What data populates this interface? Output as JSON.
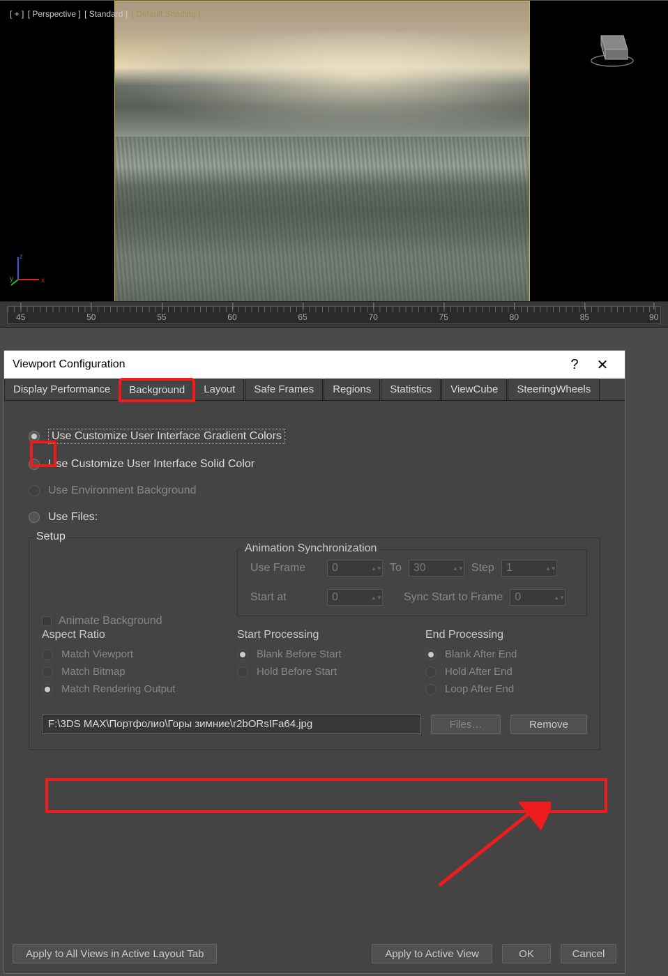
{
  "viewport": {
    "labels": {
      "plus": "[ + ]",
      "view": "[ Perspective ]",
      "mode": "[ Standard ]",
      "shading": "[ Default Shading ]"
    },
    "axis": {
      "x": "x",
      "y": "y",
      "z": "z"
    }
  },
  "timeline": {
    "ticks": [
      "45",
      "50",
      "55",
      "60",
      "65",
      "70",
      "75",
      "80",
      "85",
      "90"
    ]
  },
  "dialog": {
    "title": "Viewport Configuration",
    "help": "?",
    "close": "✕",
    "tabs": {
      "display_perf": "Display Performance",
      "background": "Background",
      "layout": "Layout",
      "safe_frames": "Safe Frames",
      "regions": "Regions",
      "statistics": "Statistics",
      "viewcube": "ViewCube",
      "steering": "SteeringWheels"
    },
    "bg": {
      "r_gradient": "Use Customize User Interface Gradient Colors",
      "r_solid": "Use Customize User Interface Solid Color",
      "r_env": "Use Environment Background",
      "r_files": "Use Files:",
      "setup": "Setup",
      "animate": "Animate Background",
      "anim_sync": "Animation Synchronization",
      "use_frame": "Use Frame",
      "use_frame_val": "0",
      "to": "To",
      "to_val": "30",
      "step": "Step",
      "step_val": "1",
      "start_at": "Start at",
      "start_at_val": "0",
      "sync_start": "Sync Start to Frame",
      "sync_start_val": "0",
      "aspect_ratio": "Aspect Ratio",
      "ar_viewport": "Match Viewport",
      "ar_bitmap": "Match Bitmap",
      "ar_render": "Match Rendering Output",
      "start_proc": "Start Processing",
      "sp_blank": "Blank Before Start",
      "sp_hold": "Hold Before Start",
      "end_proc": "End Processing",
      "ep_blank": "Blank After End",
      "ep_hold": "Hold After End",
      "ep_loop": "Loop After End",
      "file_path": "F:\\3DS MAX\\Портфолио\\Горы зимние\\r2bORsIFa64.jpg",
      "files_btn": "Files…",
      "remove_btn": "Remove"
    },
    "footer": {
      "apply_all": "Apply to All Views in Active Layout Tab",
      "apply_active": "Apply to Active View",
      "ok": "OK",
      "cancel": "Cancel"
    }
  }
}
